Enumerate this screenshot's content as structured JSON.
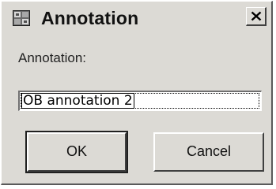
{
  "window": {
    "title": "Annotation",
    "app_icon": "app-window-icon",
    "close_icon": "close-icon"
  },
  "form": {
    "prompt_label": "Annotation:",
    "input_value": "OB annotation 2"
  },
  "buttons": {
    "ok_label": "OK",
    "cancel_label": "Cancel"
  },
  "colors": {
    "dialog_background": "#dcdad5",
    "input_background": "#ffffff",
    "text": "#111111"
  }
}
